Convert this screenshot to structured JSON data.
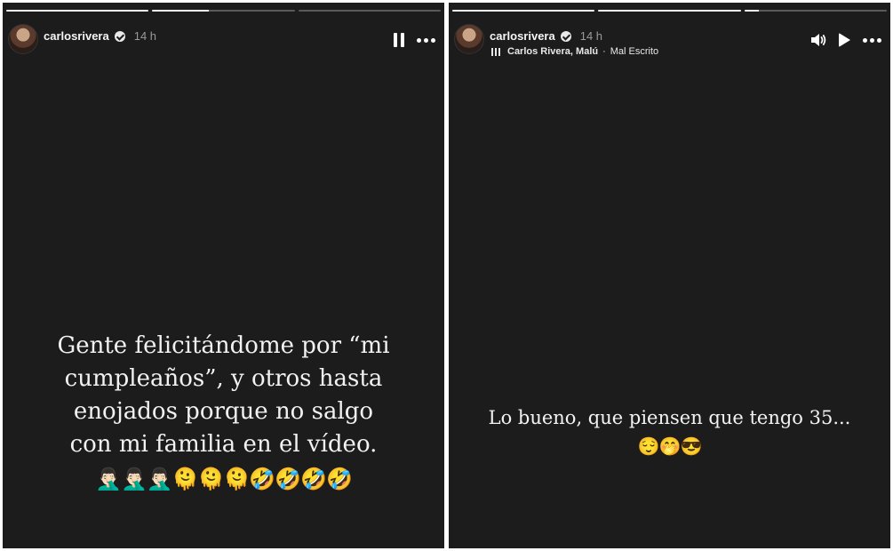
{
  "stories": [
    {
      "username": "carlosrivera",
      "time": "14 h",
      "progress": [
        1.0,
        0.4,
        0.0
      ],
      "caption_lines": [
        "Gente felicitándome por “mi",
        "cumpleaños”, y otros hasta",
        "enojados porque no salgo",
        "con mi familia en el vídeo."
      ],
      "emojis": "🤦🏻‍♂️🤦🏻‍♂️🤦🏻‍♂️🫠🫠🫠🤣🤣🤣🤣"
    },
    {
      "username": "carlosrivera",
      "time": "14 h",
      "progress": [
        1.0,
        1.0,
        0.1
      ],
      "music": {
        "artists": "Carlos Rivera, Malú",
        "separator": "·",
        "song": "Mal Escrito"
      },
      "caption_lines": [
        "Lo bueno, que piensen que tengo 35..."
      ],
      "emojis": "😌🤭😎"
    }
  ]
}
